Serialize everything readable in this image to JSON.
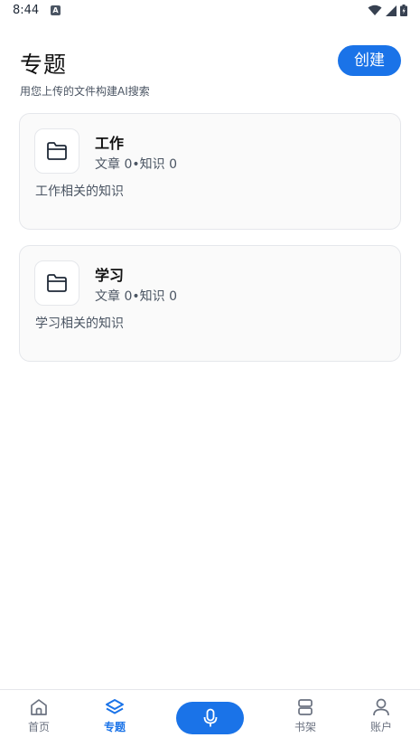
{
  "status_bar": {
    "time": "8:44",
    "notification_letter": "A"
  },
  "header": {
    "title": "专题",
    "subtitle": "用您上传的文件构建AI搜索",
    "create_label": "创建"
  },
  "topics": [
    {
      "title": "工作",
      "stats": "文章 0•知识 0",
      "description": "工作相关的知识",
      "icon": "folder-icon"
    },
    {
      "title": "学习",
      "stats": "文章 0•知识 0",
      "description": "学习相关的知识",
      "icon": "folder-icon"
    }
  ],
  "bottom_nav": {
    "items": [
      {
        "label": "首页",
        "icon": "home-icon",
        "active": false
      },
      {
        "label": "专题",
        "icon": "layers-icon",
        "active": true
      },
      {
        "label": "",
        "icon": "microphone-icon",
        "active": false
      },
      {
        "label": "书架",
        "icon": "bookshelf-icon",
        "active": false
      },
      {
        "label": "账户",
        "icon": "user-icon",
        "active": false
      }
    ]
  },
  "colors": {
    "accent": "#1a73e8",
    "card_bg": "#fafafa",
    "border": "#e5e7eb",
    "muted_text": "#4b5563"
  }
}
